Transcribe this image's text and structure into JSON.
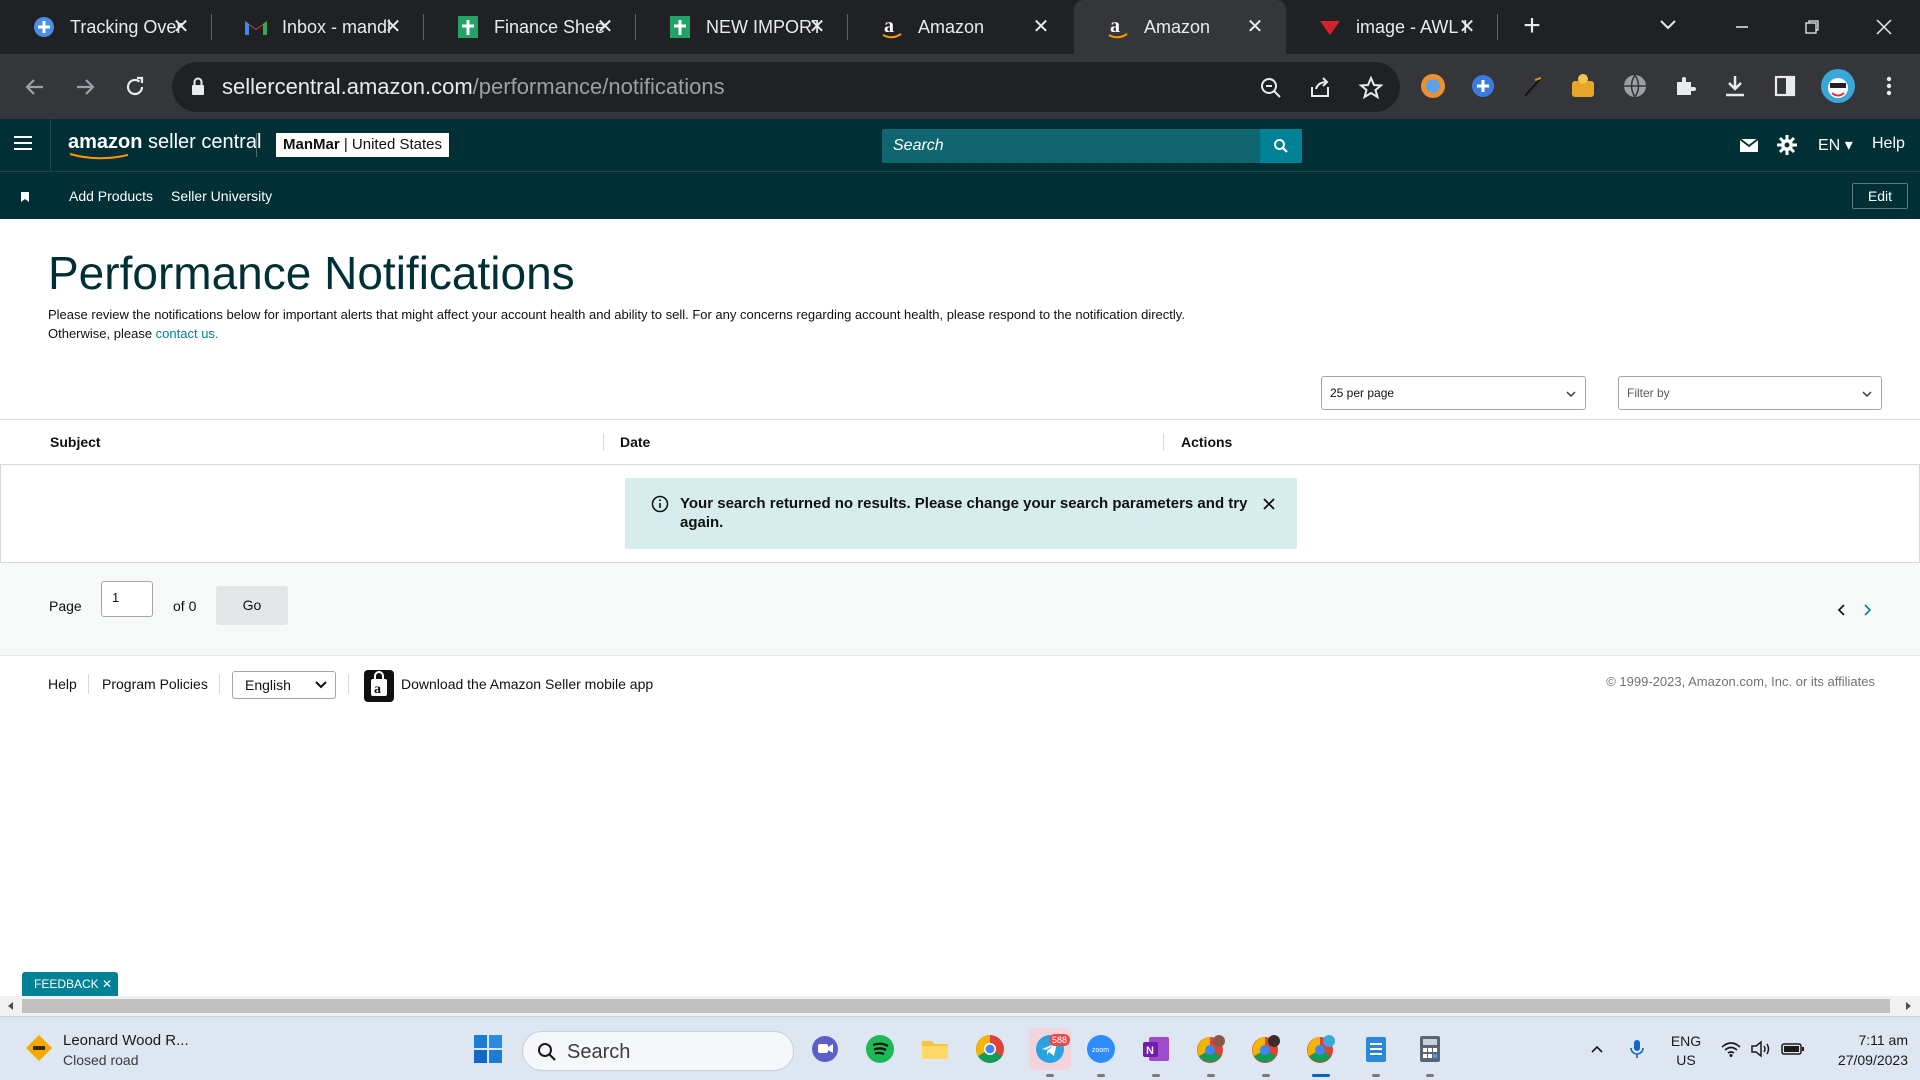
{
  "browser": {
    "tabs": [
      {
        "title": "Tracking Overv",
        "icon": "tracking-icon",
        "active": false
      },
      {
        "title": "Inbox - mandi",
        "icon": "gmail-icon",
        "active": false
      },
      {
        "title": "Finance Sheet",
        "icon": "sheets-icon",
        "active": false
      },
      {
        "title": "NEW IMPORTA",
        "icon": "sheets-icon",
        "active": false
      },
      {
        "title": "Amazon",
        "icon": "amazon-icon",
        "active": false
      },
      {
        "title": "Amazon",
        "icon": "amazon-icon",
        "active": true
      },
      {
        "title": "image - AWL I",
        "icon": "awl-icon",
        "active": false
      }
    ],
    "url_domain": "sellercentral.amazon.com",
    "url_path": "/performance/notifications"
  },
  "header": {
    "logo_bold": "amazon",
    "logo_rest": " seller central",
    "store_name": "ManMar",
    "store_sep": " | ",
    "store_region": "United States",
    "search_placeholder": "Search",
    "language": "EN",
    "help": "Help"
  },
  "nav": {
    "links": [
      "Add Products",
      "Seller University"
    ],
    "edit": "Edit"
  },
  "main": {
    "title": "Performance Notifications",
    "desc_line1": "Please review the notifications below for important alerts that might affect your account health and ability to sell. For any concerns regarding account health, please respond to the notification directly.",
    "desc_line2_prefix": "Otherwise, please ",
    "desc_link": "contact us.",
    "per_page": "25 per page",
    "filter": "Filter by",
    "columns": [
      "Subject",
      "Date",
      "Actions"
    ],
    "alert": "Your search returned no results. Please change your search parameters and try again."
  },
  "pager": {
    "page_label": "Page",
    "page_value": "1",
    "of_label": "of 0",
    "go": "Go"
  },
  "footer": {
    "help": "Help",
    "policies": "Program Policies",
    "language": "English",
    "app_download": "Download the Amazon Seller mobile app",
    "copyright": "© 1999-2023, Amazon.com, Inc. or its affiliates"
  },
  "feedback": "FEEDBACK",
  "taskbar": {
    "weather_title": "Leonard Wood R...",
    "weather_sub": "Closed road",
    "search": "Search",
    "telegram_badge": "588",
    "lang_top": "ENG",
    "lang_bottom": "US",
    "time": "7:11 am",
    "date": "27/09/2023"
  },
  "colors": {
    "amazon_header": "#002f36",
    "accent_teal": "#008296",
    "alert_bg": "#d7ecec"
  }
}
